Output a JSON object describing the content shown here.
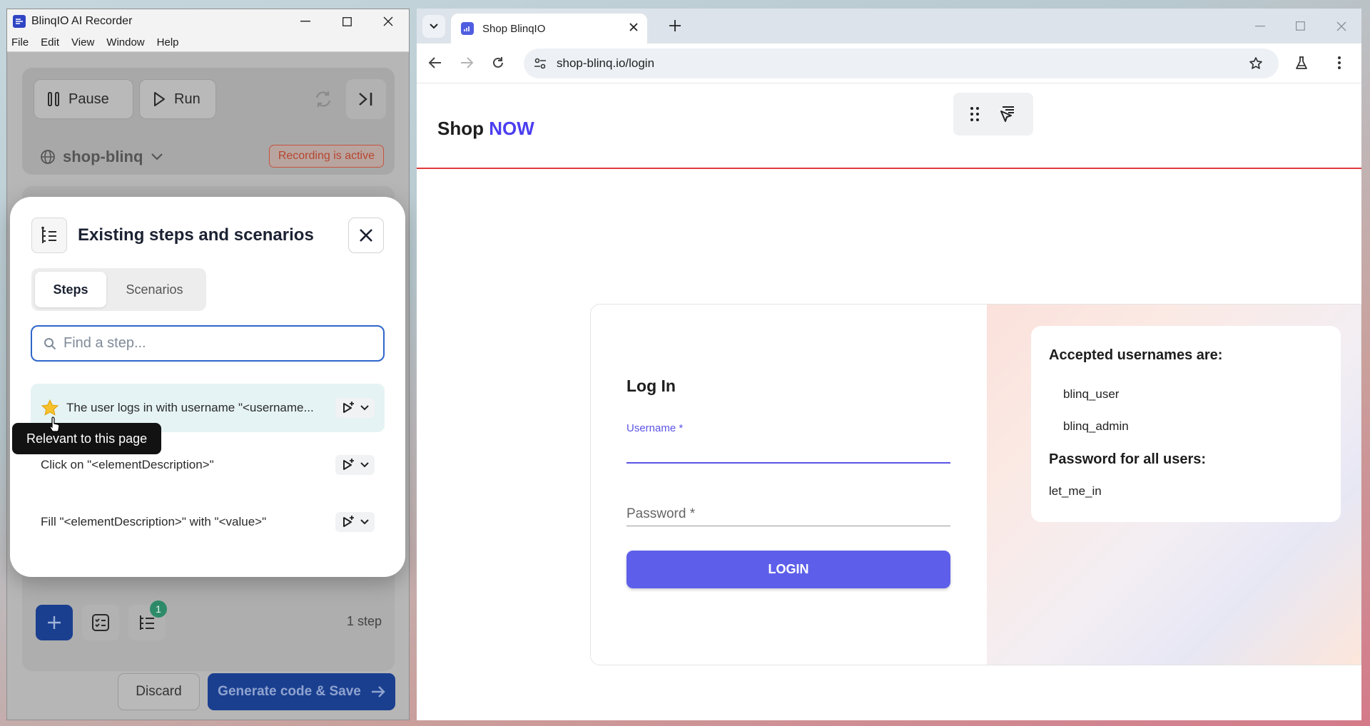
{
  "recorder": {
    "title": "BlinqIO AI Recorder",
    "menu": [
      "File",
      "Edit",
      "View",
      "Window",
      "Help"
    ],
    "pause_label": "Pause",
    "run_label": "Run",
    "project": "shop-blinq",
    "recording_status": "Recording is active",
    "notification_count": "1",
    "step_count": "1 step",
    "discard_label": "Discard",
    "generate_label": "Generate code & Save"
  },
  "modal": {
    "title": "Existing steps and scenarios",
    "tabs": [
      {
        "label": "Steps",
        "active": true
      },
      {
        "label": "Scenarios",
        "active": false
      }
    ],
    "search_placeholder": "Find a step...",
    "steps": [
      {
        "text": "The user logs in with username \"<username...",
        "starred": true
      },
      {
        "text": "Click on \"<elementDescription>\"",
        "starred": false
      },
      {
        "text": "Fill \"<elementDescription>\" with \"<value>\"",
        "starred": false
      }
    ],
    "tooltip": "Relevant to this page"
  },
  "browser": {
    "tab_title": "Shop BlinqIO",
    "url": "shop-blinq.io/login"
  },
  "shop": {
    "logo_main": "Shop ",
    "logo_accent": "NOW",
    "login_title": "Log In",
    "username_label": "Username *",
    "password_label": "Password *",
    "login_button": "LOGIN",
    "info_heading_users": "Accepted usernames are:",
    "usernames": [
      "blinq_user",
      "blinq_admin"
    ],
    "info_heading_password": "Password for all users:",
    "password_value": "let_me_in"
  },
  "colors": {
    "accent": "#5d5fea",
    "recorder_primary": "#1a3f8f",
    "recording_red": "#c4553f",
    "header_line": "#e03a3a"
  }
}
